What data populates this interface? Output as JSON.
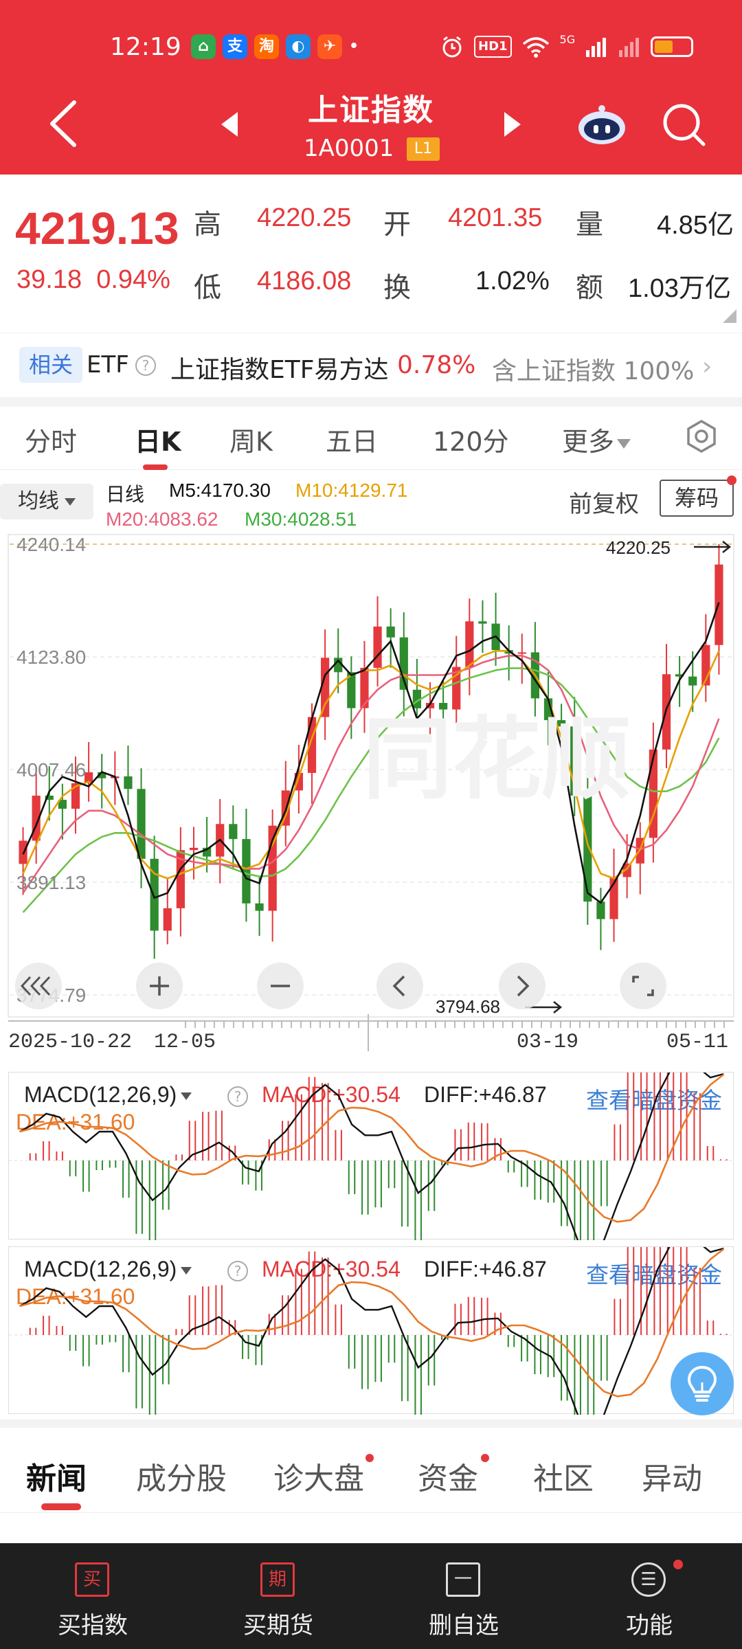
{
  "status": {
    "time": "12:19",
    "apps": [
      {
        "icon": "home-app-icon",
        "glyph": "⌂",
        "color": "#2fa84f"
      },
      {
        "icon": "alipay-icon",
        "glyph": "支",
        "color": "#1677ff"
      },
      {
        "icon": "taobao-icon",
        "glyph": "淘",
        "color": "#ff6a00"
      },
      {
        "icon": "browser-icon",
        "glyph": "◐",
        "color": "#1e88e5"
      },
      {
        "icon": "paper-plane-icon",
        "glyph": "✈",
        "color": "#ff5a1f"
      }
    ],
    "hd_label": "HD1",
    "signal_label": "5G"
  },
  "nav": {
    "title": "上证指数",
    "code": "1A0001",
    "level_tag": "L1"
  },
  "quote": {
    "price": "4219.13",
    "change": "39.18",
    "change_pct": "0.94%",
    "labels": {
      "high": "高",
      "open": "开",
      "volume": "量",
      "low": "低",
      "turnover": "换",
      "amount": "额"
    },
    "high": "4220.25",
    "open": "4201.35",
    "volume": "4.85亿",
    "low": "4186.08",
    "turnover_rate": "1.02%",
    "amount": "1.03万亿"
  },
  "related": {
    "tag": "相关",
    "etf_label": "ETF",
    "help": "?",
    "name": "上证指数ETF易方达",
    "pct": "0.78%",
    "holding_label": "含上证指数",
    "holding_pct": "100%"
  },
  "tabs": [
    {
      "label": "分时"
    },
    {
      "label": "日K"
    },
    {
      "label": "周K"
    },
    {
      "label": "五日"
    },
    {
      "label": "120分"
    },
    {
      "label": "更多"
    }
  ],
  "kline": {
    "ma_toggle": "均线",
    "series_label": "日线",
    "ma5": "M5:4170.30",
    "ma10": "M10:4129.71",
    "ma20": "M20:4083.62",
    "ma30": "M30:4028.51",
    "adjust": "前复权",
    "chips": "筹码",
    "colors": {
      "up": "#e4393c",
      "down": "#2e8b2e",
      "ma5": "#111111",
      "ma10": "#e6a000",
      "ma20": "#e8607a",
      "ma30": "#6cc24a"
    }
  },
  "chart_data": {
    "type": "candlestick",
    "y_ticks": [
      "4240.14",
      "4123.80",
      "4007.46",
      "3891.13",
      "3774.79"
    ],
    "ylim": [
      3774.79,
      4240.14
    ],
    "high_marker": "4220.25",
    "low_marker": "3794.68",
    "x_labels": [
      "2025-10-22",
      "12-05",
      "03-19",
      "05-11"
    ],
    "ma5": [
      3920,
      3950,
      3985,
      4000,
      3995,
      3990,
      4005,
      4000,
      3960,
      3910,
      3875,
      3880,
      3905,
      3920,
      3925,
      3935,
      3920,
      3895,
      3890,
      3935,
      3965,
      4010,
      4060,
      4105,
      4120,
      4105,
      4110,
      4125,
      4140,
      4100,
      4060,
      4075,
      4100,
      4125,
      4130,
      4140,
      4145,
      4130,
      4120,
      4100,
      4080,
      4030,
      3950,
      3880,
      3870,
      3890,
      3915,
      3960,
      4020,
      4070,
      4100,
      4120,
      4140,
      4180
    ],
    "ma10": [
      3900,
      3930,
      3960,
      3980,
      3990,
      3995,
      3985,
      3965,
      3940,
      3915,
      3900,
      3895,
      3900,
      3905,
      3910,
      3915,
      3910,
      3905,
      3910,
      3930,
      3960,
      4000,
      4040,
      4075,
      4095,
      4105,
      4110,
      4110,
      4115,
      4105,
      4095,
      4090,
      4095,
      4105,
      4115,
      4125,
      4130,
      4130,
      4120,
      4105,
      4080,
      4040,
      3990,
      3930,
      3900,
      3895,
      3905,
      3925,
      3960,
      4000,
      4040,
      4075,
      4100,
      4130
    ],
    "ma20": [
      3880,
      3900,
      3920,
      3940,
      3955,
      3965,
      3965,
      3960,
      3950,
      3940,
      3930,
      3920,
      3915,
      3912,
      3910,
      3910,
      3908,
      3905,
      3905,
      3912,
      3925,
      3945,
      3970,
      4000,
      4030,
      4055,
      4075,
      4090,
      4100,
      4105,
      4105,
      4105,
      4105,
      4108,
      4112,
      4118,
      4122,
      4125,
      4125,
      4120,
      4110,
      4090,
      4060,
      4020,
      3980,
      3950,
      3930,
      3925,
      3930,
      3945,
      3965,
      3990,
      4025,
      4060
    ],
    "ma30": [
      3860,
      3875,
      3890,
      3905,
      3920,
      3930,
      3938,
      3942,
      3942,
      3938,
      3934,
      3928,
      3922,
      3918,
      3914,
      3910,
      3905,
      3900,
      3897,
      3898,
      3905,
      3918,
      3935,
      3955,
      3978,
      4000,
      4020,
      4040,
      4055,
      4068,
      4078,
      4086,
      4092,
      4097,
      4102,
      4106,
      4110,
      4112,
      4112,
      4110,
      4105,
      4095,
      4080,
      4060,
      4040,
      4020,
      4000,
      3990,
      3985,
      3985,
      3990,
      4000,
      4015,
      4040
    ]
  },
  "macd": {
    "name": "MACD(12,26,9)",
    "help": "?",
    "macd": "MACD:+30.54",
    "diff": "DIFF:+46.87",
    "dea": "DEA:+31.60",
    "dark_pool": "查看暗盘资金"
  },
  "content_tabs": [
    {
      "label": "新闻"
    },
    {
      "label": "成分股"
    },
    {
      "label": "诊大盘"
    },
    {
      "label": "资金"
    },
    {
      "label": "社区"
    },
    {
      "label": "异动"
    }
  ],
  "bottom": [
    {
      "icon_glyph": "买",
      "label": "买指数"
    },
    {
      "icon_glyph": "期",
      "label": "买期货"
    },
    {
      "icon_glyph": "一",
      "label": "删自选"
    },
    {
      "icon_glyph": "☰",
      "label": "功能"
    }
  ]
}
